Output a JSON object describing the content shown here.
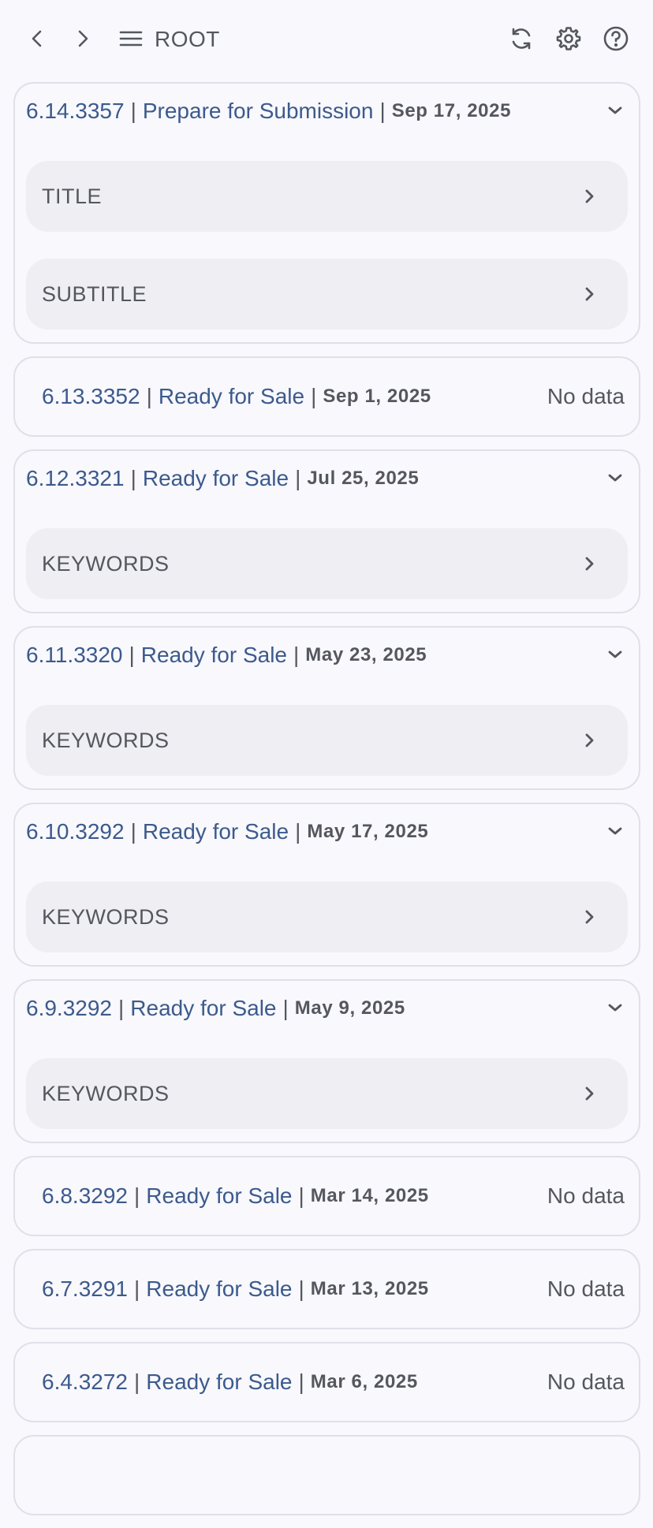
{
  "toolbar": {
    "back_icon": "chevron-left-icon",
    "forward_icon": "chevron-right-icon",
    "menu_icon": "hamburger-menu-icon",
    "root_label": "ROOT",
    "refresh_icon": "refresh-icon",
    "settings_icon": "gear-icon",
    "help_icon": "help-circle-icon"
  },
  "versions": [
    {
      "version": "6.14.3357",
      "status": "Prepare for Submission",
      "date": "Sep 17, 2025",
      "expanded": true,
      "rows": [
        "TITLE",
        "SUBTITLE"
      ]
    },
    {
      "version": "6.13.3352",
      "status": "Ready for Sale",
      "date": "Sep 1, 2025",
      "expanded": false,
      "nodata": "No data"
    },
    {
      "version": "6.12.3321",
      "status": "Ready for Sale",
      "date": "Jul 25, 2025",
      "expanded": true,
      "rows": [
        "KEYWORDS"
      ]
    },
    {
      "version": "6.11.3320",
      "status": "Ready for Sale",
      "date": "May 23, 2025",
      "expanded": true,
      "rows": [
        "KEYWORDS"
      ]
    },
    {
      "version": "6.10.3292",
      "status": "Ready for Sale",
      "date": "May 17, 2025",
      "expanded": true,
      "rows": [
        "KEYWORDS"
      ]
    },
    {
      "version": "6.9.3292",
      "status": "Ready for Sale",
      "date": "May 9, 2025",
      "expanded": true,
      "rows": [
        "KEYWORDS"
      ]
    },
    {
      "version": "6.8.3292",
      "status": "Ready for Sale",
      "date": "Mar 14, 2025",
      "expanded": false,
      "nodata": "No data"
    },
    {
      "version": "6.7.3291",
      "status": "Ready for Sale",
      "date": "Mar 13, 2025",
      "expanded": false,
      "nodata": "No data"
    },
    {
      "version": "6.4.3272",
      "status": "Ready for Sale",
      "date": "Mar 6, 2025",
      "expanded": false,
      "nodata": "No data"
    }
  ],
  "colors": {
    "background": "#f8f8fd",
    "link_blue": "#3c5a8c",
    "text_gray": "#55575e",
    "row_bg": "#eeeef3",
    "card_border": "#dfe0e8"
  }
}
